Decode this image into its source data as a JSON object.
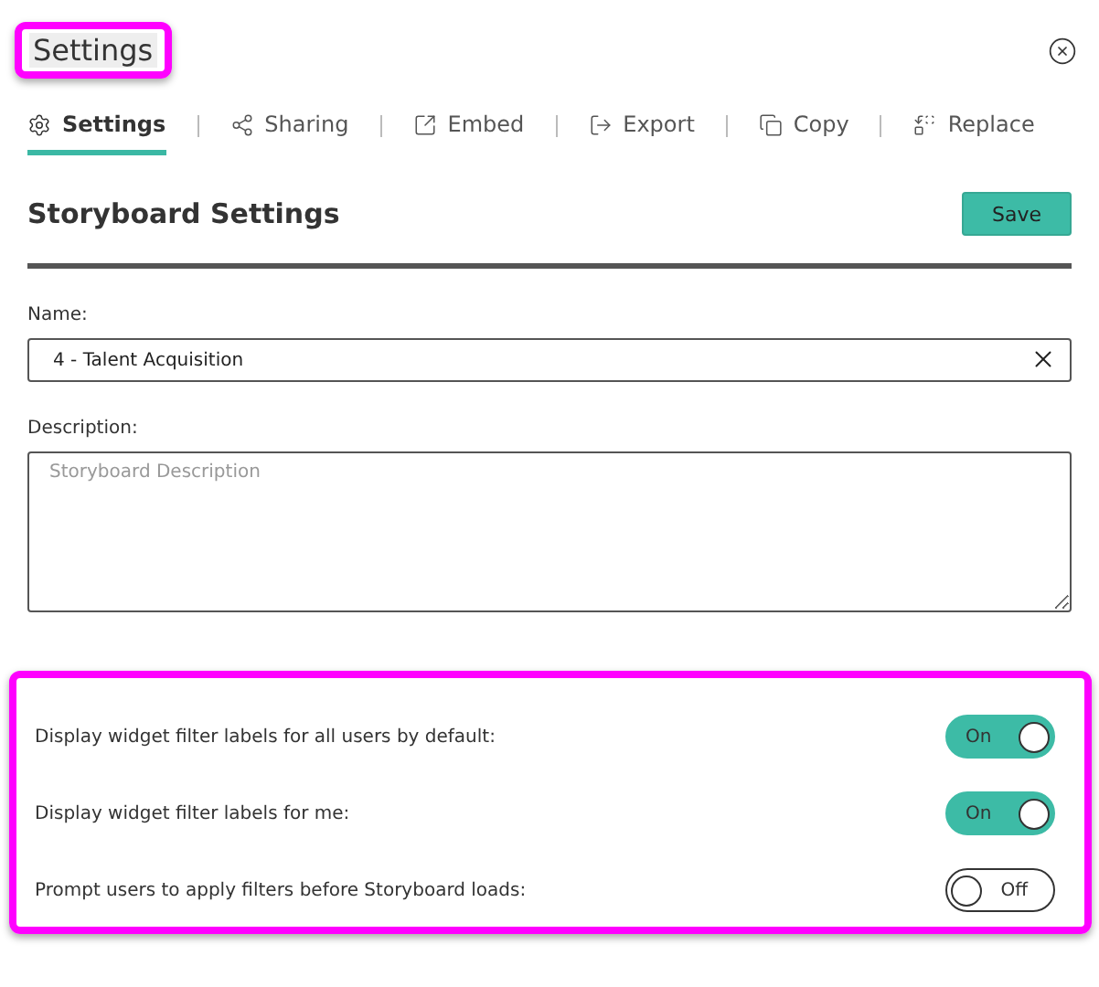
{
  "dialog": {
    "title": "Settings"
  },
  "tabs": [
    {
      "label": "Settings",
      "selected": true
    },
    {
      "label": "Sharing",
      "selected": false
    },
    {
      "label": "Embed",
      "selected": false
    },
    {
      "label": "Export",
      "selected": false
    },
    {
      "label": "Copy",
      "selected": false
    },
    {
      "label": "Replace",
      "selected": false
    }
  ],
  "section": {
    "title": "Storyboard Settings",
    "save_button": "Save"
  },
  "name_field": {
    "label": "Name:",
    "value": "4 - Talent Acquisition"
  },
  "description_field": {
    "label": "Description:",
    "placeholder": "Storyboard Description"
  },
  "toggles": [
    {
      "label": "Display widget filter labels for all users by default:",
      "on": true,
      "state_text": "On"
    },
    {
      "label": "Display widget filter labels for me:",
      "on": true,
      "state_text": "On"
    },
    {
      "label": "Prompt users to apply filters before Storyboard loads:",
      "on": false,
      "state_text": "Off"
    }
  ]
}
